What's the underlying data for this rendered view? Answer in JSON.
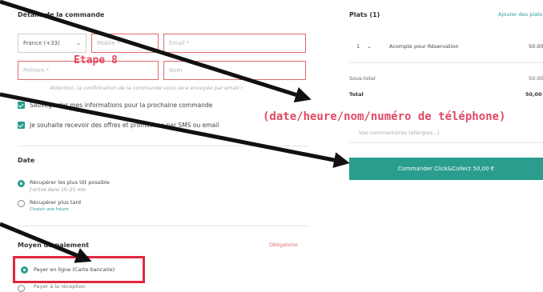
{
  "order_details": {
    "title": "Détails de la commande",
    "phone_country": "France (+33)",
    "phone_placeholder": "Mobile *",
    "email_placeholder": "Email *",
    "firstname_placeholder": "Prénom *",
    "lastname_placeholder": "Nom",
    "confirmation_hint": "Attention, la confirmation de la commande vous sera envoyée par email !",
    "save_info_label": "Sauvegarder mes informations pour la prochaine commande",
    "offers_label": "Je souhaite recevoir des offres et promotions par SMS ou email"
  },
  "date": {
    "title": "Date",
    "option_asap": "Récupérer les plus tôt possible",
    "option_asap_sub": "J'arrive dans 10–25 min",
    "option_later": "Récupérer plus tard",
    "option_later_link": "Choisir une heure"
  },
  "payment": {
    "title": "Moyen de paiement",
    "required": "Obligatoire",
    "option_online": "Payer en ligne (Carte bancaire)",
    "option_onsite": "Payer à la réception"
  },
  "cart": {
    "title": "Plats (1)",
    "add_link": "Ajouter des plats",
    "qty": "1",
    "item_name": "Acompte pour Réservation",
    "item_price": "50,00 €",
    "subtotal_label": "Sous-total",
    "subtotal_value": "50,00 €",
    "total_label": "Total",
    "total_value": "50,00 €",
    "comment_placeholder": "Vos commentaires (allergies...)",
    "cta": "Commander Click&Collect 50,00 €"
  },
  "annotations": {
    "step_label": "Etape 8",
    "fields_note": "(date/heure/nom/numéro de téléphone)",
    "arrow_color": "#111111",
    "highlight_color": "#e0263f",
    "label_color": "#e04a63"
  }
}
